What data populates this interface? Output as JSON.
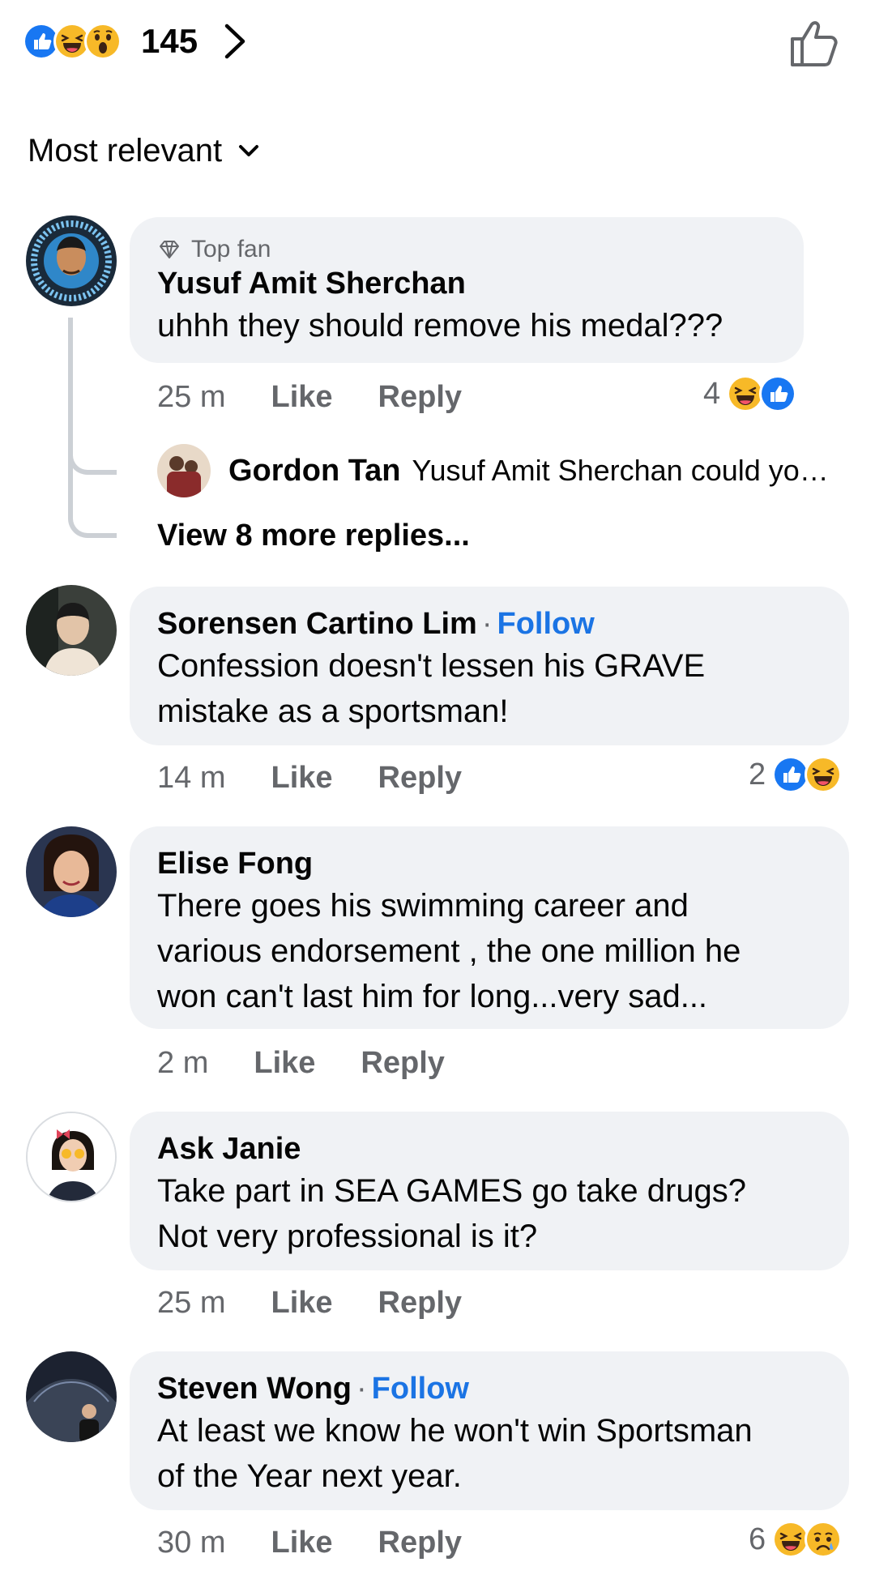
{
  "header": {
    "reaction_count": "145",
    "reaction_icons": [
      "like-icon",
      "haha-icon",
      "wow-icon"
    ]
  },
  "sort": {
    "label": "Most relevant"
  },
  "comments": [
    {
      "badge": "Top fan",
      "name": "Yusuf Amit Sherchan",
      "text": "uhhh they should remove his medal???",
      "time": "25 m",
      "like": "Like",
      "reply": "Reply",
      "reaction_count": "4",
      "reaction_icons": [
        "haha-icon",
        "like-icon"
      ],
      "reply_preview": {
        "name": "Gordon Tan",
        "text": "Yusuf Amit Sherchan could you..."
      },
      "more_replies": "View 8 more replies..."
    },
    {
      "name": "Sorensen Cartino Lim",
      "follow": "Follow",
      "text_lines": [
        "Confession doesn't lessen his GRAVE",
        "mistake as a sportsman!"
      ],
      "time": "14 m",
      "like": "Like",
      "reply": "Reply",
      "reaction_count": "2",
      "reaction_icons": [
        "like-icon",
        "haha-icon"
      ]
    },
    {
      "name": "Elise Fong",
      "text_lines": [
        "There goes his swimming career and",
        "various endorsement , the one million he",
        "won can't last him for long...very sad..."
      ],
      "time": "2 m",
      "like": "Like",
      "reply": "Reply"
    },
    {
      "name": "Ask Janie",
      "text_lines": [
        "Take part in SEA GAMES go take drugs?",
        "Not very professional is it?"
      ],
      "time": "25 m",
      "like": "Like",
      "reply": "Reply"
    },
    {
      "name": "Steven Wong",
      "follow": "Follow",
      "text_lines": [
        "At least we know he won't win Sportsman",
        "of the Year next year."
      ],
      "time": "30 m",
      "like": "Like",
      "reply": "Reply",
      "reaction_count": "6",
      "reaction_icons": [
        "haha-icon",
        "sad-icon"
      ]
    }
  ],
  "colors": {
    "bubble": "#f0f2f5",
    "secondary_text": "#65676b",
    "link": "#1b74e4",
    "like_blue": "#1877f2",
    "emoji_yellow": "#f7b928"
  }
}
